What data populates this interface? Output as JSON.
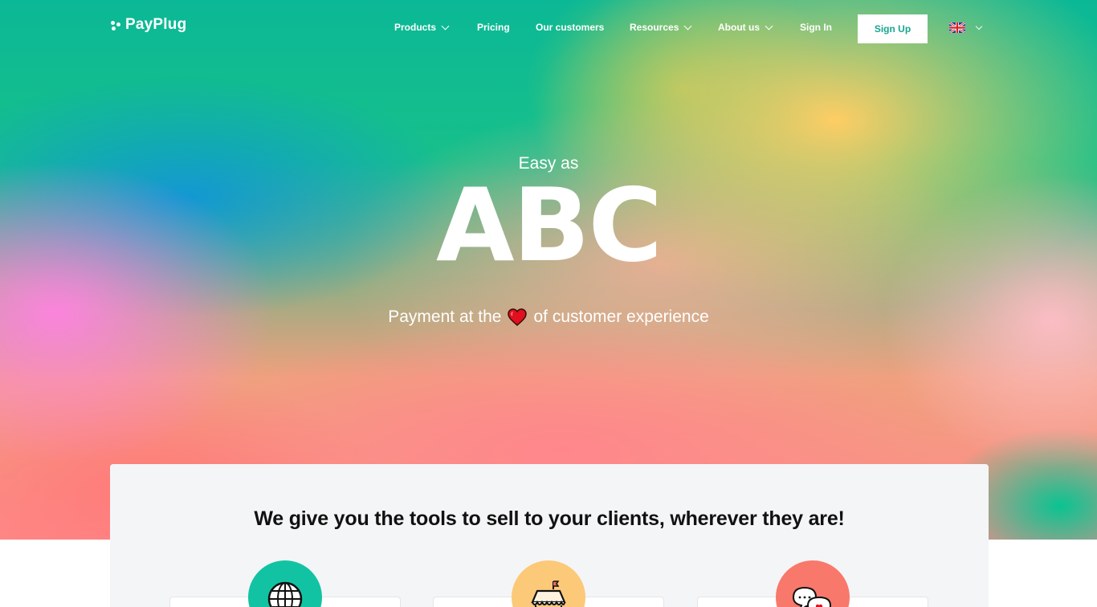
{
  "brand": {
    "name": "PayPlug"
  },
  "nav": {
    "items": [
      {
        "label": "Products",
        "has_dropdown": true
      },
      {
        "label": "Pricing",
        "has_dropdown": false
      },
      {
        "label": "Our customers",
        "has_dropdown": false
      },
      {
        "label": "Resources",
        "has_dropdown": true
      },
      {
        "label": "About us",
        "has_dropdown": true
      },
      {
        "label": "Sign In",
        "has_dropdown": false
      }
    ],
    "signup_label": "Sign Up",
    "language": {
      "icon": "uk-flag-icon",
      "selected": "EN"
    }
  },
  "hero": {
    "kicker": "Easy as",
    "headline": "ABC",
    "tagline_before": "Payment at the",
    "tagline_icon": "heart-icon",
    "tagline_after": "of customer experience"
  },
  "features": {
    "title": "We give you the tools to sell to your clients, wherever they are!",
    "items": [
      {
        "icon": "globe-icon",
        "color": "#12c3a3"
      },
      {
        "icon": "shop-icon",
        "color": "#fcc979"
      },
      {
        "icon": "chat-bubbles-icon",
        "color": "#f8786b"
      }
    ]
  },
  "colors": {
    "accent": "#1aa58f",
    "text_dark": "#111111",
    "panel_bg": "#f4f5f6"
  }
}
